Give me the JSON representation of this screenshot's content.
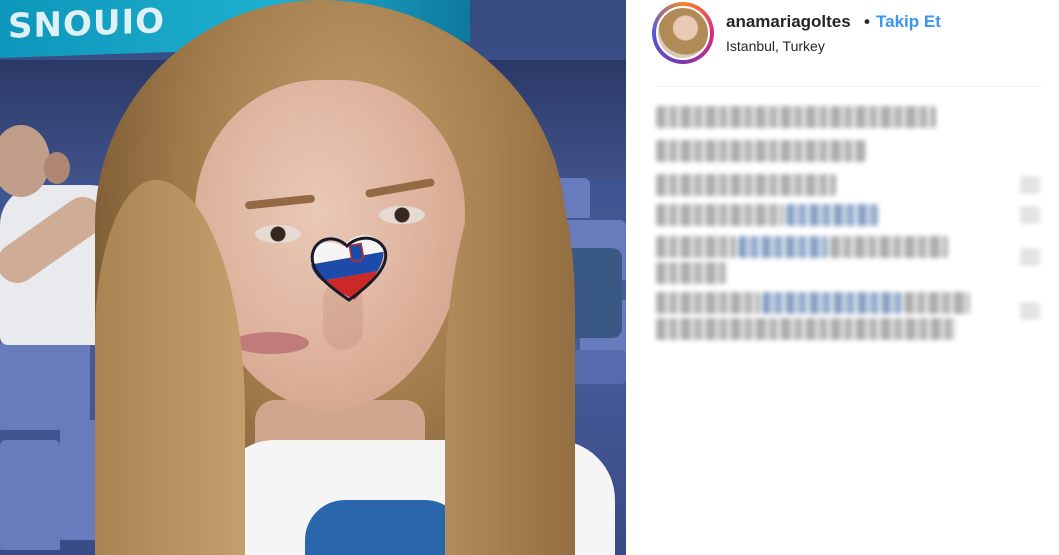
{
  "post": {
    "username": "anamariagoltes",
    "separator": "•",
    "follow_label": "Takip Et",
    "location": "Istanbul, Turkey"
  },
  "photo": {
    "banner_text": "SNOUIO"
  },
  "icons": {
    "avatar": "profile-avatar",
    "heart_flag": "slovenia-heart-face-paint"
  },
  "colors": {
    "follow_link": "#3897f0",
    "text": "#262626",
    "avatar_ring": [
      "#f58529",
      "#dd2a7b",
      "#8134af",
      "#515bd4"
    ]
  }
}
